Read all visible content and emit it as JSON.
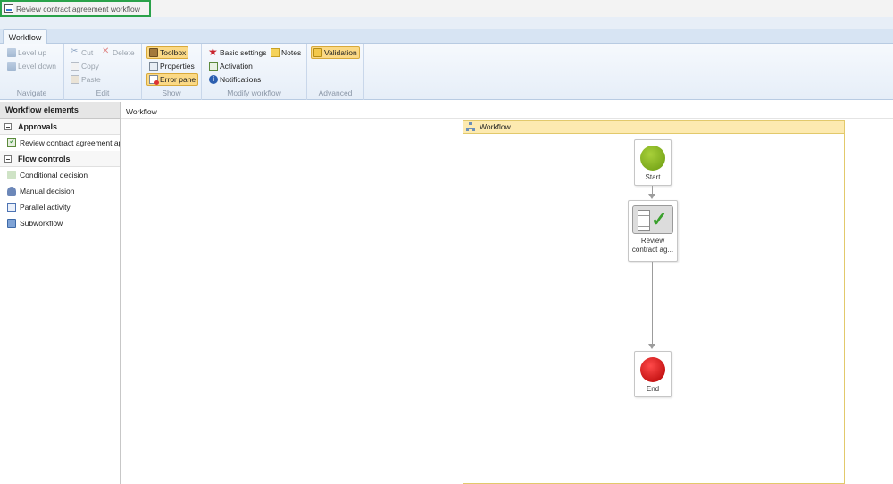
{
  "window": {
    "title": "Review contract agreement workflow"
  },
  "tabs": [
    {
      "label": "Workflow"
    }
  ],
  "ribbon": {
    "navigate": {
      "label": "Navigate",
      "level_up": "Level up",
      "level_down": "Level down"
    },
    "edit": {
      "label": "Edit",
      "cut": "Cut",
      "delete": "Delete",
      "copy": "Copy",
      "paste": "Paste"
    },
    "show": {
      "label": "Show",
      "toolbox": "Toolbox",
      "properties": "Properties",
      "error_pane": "Error pane"
    },
    "modify": {
      "label": "Modify workflow",
      "basic_settings": "Basic settings",
      "notes": "Notes",
      "activation": "Activation",
      "notifications": "Notifications"
    },
    "advanced": {
      "label": "Advanced",
      "validation": "Validation"
    }
  },
  "elements_panel": {
    "title": "Workflow elements",
    "sections": [
      {
        "label": "Approvals",
        "items": [
          {
            "label": "Review contract agreement ap",
            "icon": "approval-icon"
          }
        ]
      },
      {
        "label": "Flow controls",
        "items": [
          {
            "label": "Conditional decision",
            "icon": "conditional-decision-icon"
          },
          {
            "label": "Manual decision",
            "icon": "manual-decision-icon"
          },
          {
            "label": "Parallel activity",
            "icon": "parallel-activity-icon"
          },
          {
            "label": "Subworkflow",
            "icon": "subworkflow-icon"
          }
        ]
      }
    ]
  },
  "canvas": {
    "breadcrumb": "Workflow",
    "container_title": "Workflow",
    "nodes": {
      "start": {
        "label": "Start"
      },
      "task": {
        "label_line1": "Review",
        "label_line2": "contract ag..."
      },
      "end": {
        "label": "End"
      }
    }
  },
  "colors": {
    "accent_green": "#2aa24a",
    "active_button": "#fbd985",
    "workflow_header": "#fdeab0"
  }
}
